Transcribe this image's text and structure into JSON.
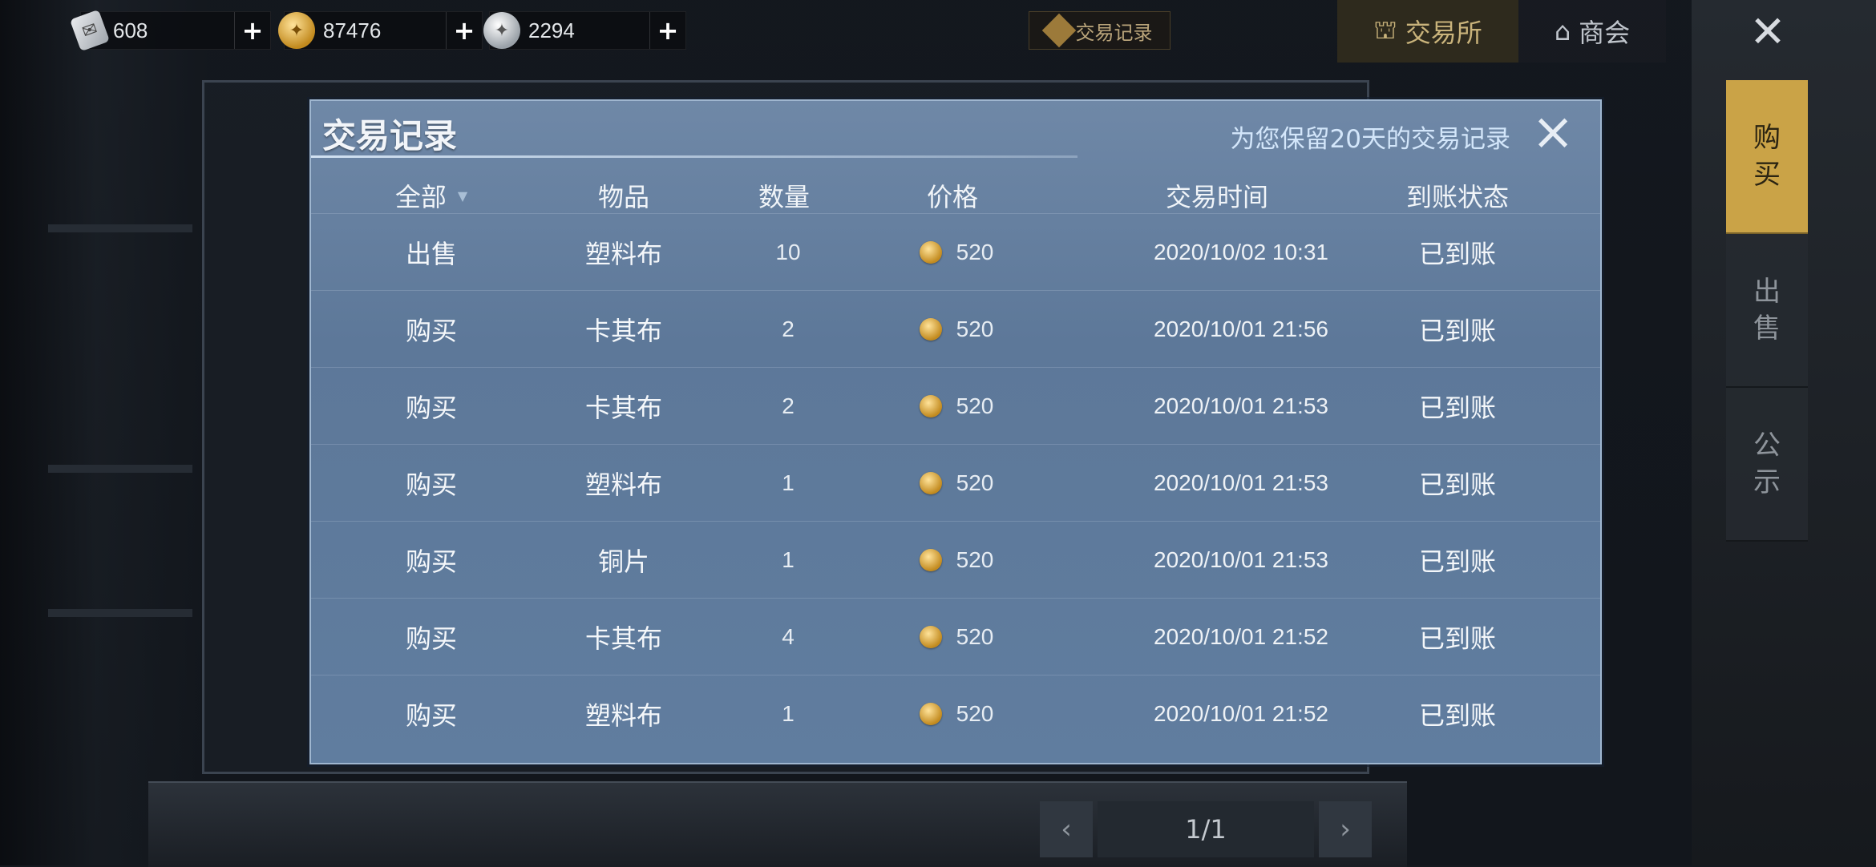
{
  "currencies": [
    {
      "value": "608",
      "icon": "ticket-icon"
    },
    {
      "value": "87476",
      "icon": "gold-coin-icon"
    },
    {
      "value": "2294",
      "icon": "silver-coin-icon"
    }
  ],
  "header": {
    "trade_record_btn": "交易记录",
    "tabs": {
      "exchange": "交易所",
      "guild": "商会"
    }
  },
  "side_tabs": {
    "buy": [
      "购",
      "买"
    ],
    "sell": [
      "出",
      "售"
    ],
    "notice": [
      "公",
      "示"
    ]
  },
  "dialog": {
    "title": "交易记录",
    "note": "为您保留20天的交易记录",
    "columns": {
      "type": "全部",
      "item": "物品",
      "qty": "数量",
      "price": "价格",
      "time": "交易时间",
      "status": "到账状态"
    },
    "rows": [
      {
        "type": "出售",
        "item": "塑料布",
        "qty": "10",
        "price": "520",
        "time": "2020/10/02  10:31",
        "status": "已到账"
      },
      {
        "type": "购买",
        "item": "卡其布",
        "qty": "2",
        "price": "520",
        "time": "2020/10/01  21:56",
        "status": "已到账"
      },
      {
        "type": "购买",
        "item": "卡其布",
        "qty": "2",
        "price": "520",
        "time": "2020/10/01  21:53",
        "status": "已到账"
      },
      {
        "type": "购买",
        "item": "塑料布",
        "qty": "1",
        "price": "520",
        "time": "2020/10/01  21:53",
        "status": "已到账"
      },
      {
        "type": "购买",
        "item": "铜片",
        "qty": "1",
        "price": "520",
        "time": "2020/10/01  21:53",
        "status": "已到账"
      },
      {
        "type": "购买",
        "item": "卡其布",
        "qty": "4",
        "price": "520",
        "time": "2020/10/01  21:52",
        "status": "已到账"
      },
      {
        "type": "购买",
        "item": "塑料布",
        "qty": "1",
        "price": "520",
        "time": "2020/10/01  21:52",
        "status": "已到账"
      }
    ]
  },
  "pager": {
    "text": "1/1"
  }
}
